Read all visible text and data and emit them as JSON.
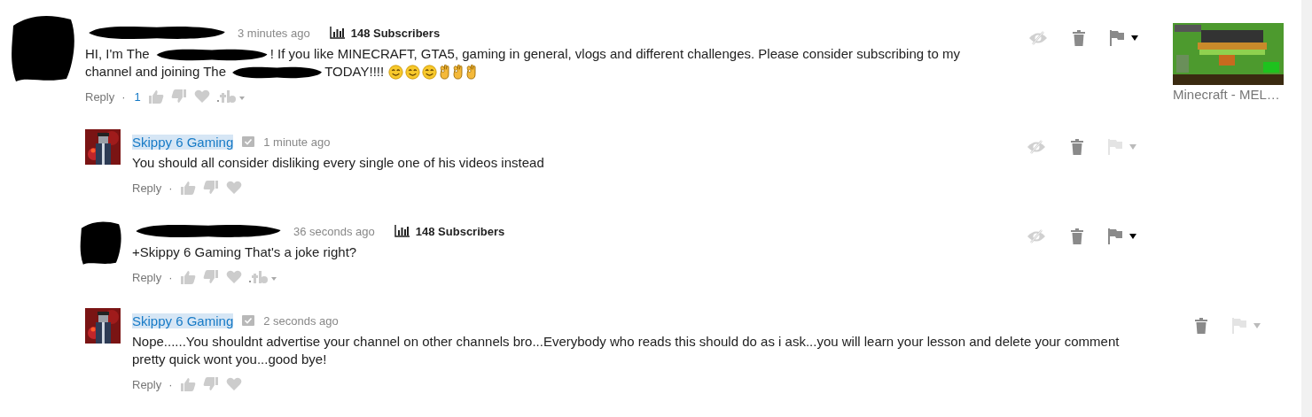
{
  "comments": [
    {
      "avatar": {
        "kind": "redacted"
      },
      "author": {
        "redacted": true
      },
      "time": "3 minutes ago",
      "subscribers": "148 Subscribers",
      "body": [
        {
          "kind": "text",
          "text": "HI, I'm The "
        },
        {
          "kind": "redacted"
        },
        {
          "kind": "text",
          "text": "! If you like MINECRAFT, GTA5, gaming in general, vlogs and different challenges. Please consider subscribing to my channel and joining The "
        },
        {
          "kind": "redacted"
        },
        {
          "kind": "text",
          "text": "TODAY!!!! "
        },
        {
          "kind": "smiley"
        },
        {
          "kind": "smiley"
        },
        {
          "kind": "smiley"
        },
        {
          "kind": "ok-hand"
        },
        {
          "kind": "ok-hand"
        },
        {
          "kind": "ok-hand"
        }
      ],
      "reply": "Reply",
      "separator": "·",
      "likes": "1",
      "creator_menu": true,
      "can_hide": true,
      "flag_enabled": true,
      "is_reply": false,
      "video": {
        "caption": "Minecraft - MEL…"
      }
    },
    {
      "author": {
        "redacted": false,
        "name": "Skippy 6 Gaming",
        "highlighted": true,
        "verified": true
      },
      "time": "1 minute ago",
      "body": [
        {
          "kind": "text",
          "text": "You should all consider disliking every single one of his videos instead"
        }
      ],
      "reply": "Reply",
      "separator": "·",
      "creator_menu": false,
      "can_hide": true,
      "flag_enabled": false,
      "is_reply": true
    },
    {
      "avatar": {
        "kind": "redacted"
      },
      "author": {
        "redacted": true
      },
      "time": "36 seconds ago",
      "subscribers": "148 Subscribers",
      "body": [
        {
          "kind": "text",
          "text": "+Skippy 6 Gaming That's a joke right?"
        }
      ],
      "reply": "Reply",
      "separator": "·",
      "creator_menu": true,
      "can_hide": true,
      "flag_enabled": true,
      "is_reply": true
    },
    {
      "author": {
        "redacted": false,
        "name": "Skippy 6 Gaming",
        "highlighted": true,
        "verified": true
      },
      "time": "2 seconds ago",
      "body": [
        {
          "kind": "text",
          "text": "Nope......You shouldnt advertise your channel on other channels bro...Everybody who reads this should do as i ask...you will learn your lesson and delete your comment pretty quick wont you...good bye!"
        }
      ],
      "reply": "Reply",
      "separator": "·",
      "creator_menu": false,
      "can_hide": false,
      "flag_enabled": false,
      "is_reply": true
    }
  ]
}
